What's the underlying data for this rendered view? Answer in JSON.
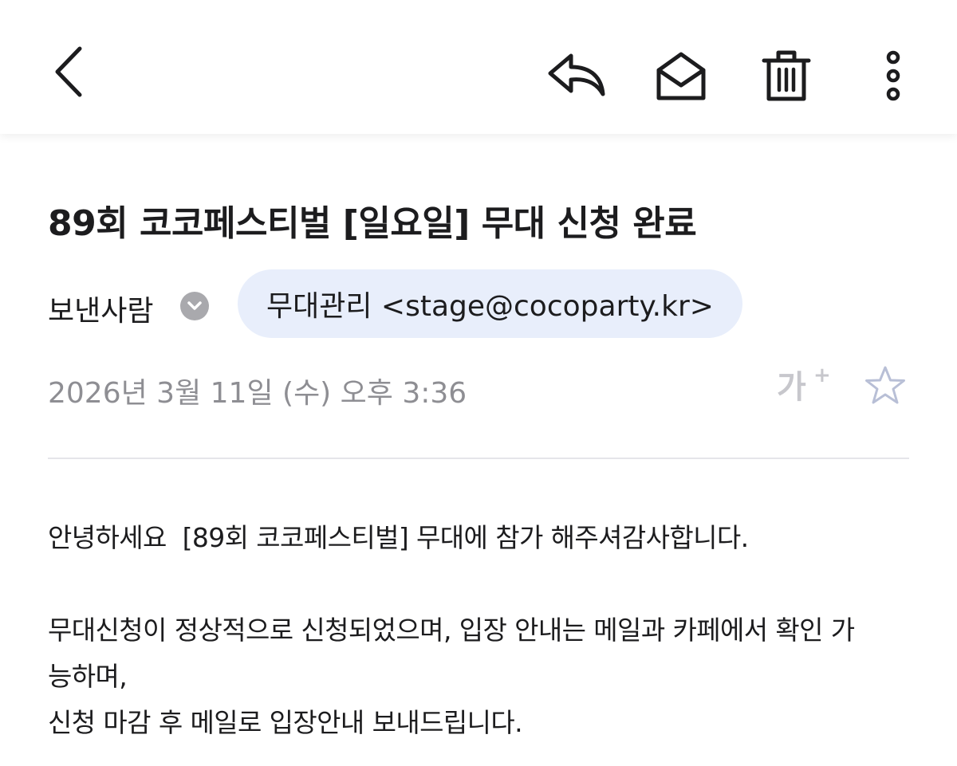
{
  "toolbar": {
    "back_icon": "chevron-left-icon",
    "reply_icon": "reply-icon",
    "mark_unread_icon": "envelope-open-icon",
    "delete_icon": "trash-icon",
    "more_icon": "more-vertical-icon"
  },
  "email": {
    "subject": "89회 코코페스티벌 [일요일] 무대 신청 완료",
    "sender_label": "보낸사람",
    "sender": "무대관리 <stage@cocoparty.kr>",
    "date": "2026년 3월 11일 (수) 오후 3:36",
    "font_size_label": "가",
    "font_size_plus": "+",
    "starred": false
  },
  "body": {
    "line1": "안녕하세요  [89회 코코페스티벌] 무대에 참가 해주셔감사합니다.",
    "line2": "무대신청이 정상적으로 신청되었으며, 입장 안내는 메일과 카페에서 확인 가",
    "line3": "능하며,",
    "line4": "신청 마감 후 메일로 입장안내 보내드립니다."
  },
  "colors": {
    "chip_bg": "#e8eefb",
    "muted_text": "#8e8e93",
    "icon_light": "#c7c7cc"
  }
}
